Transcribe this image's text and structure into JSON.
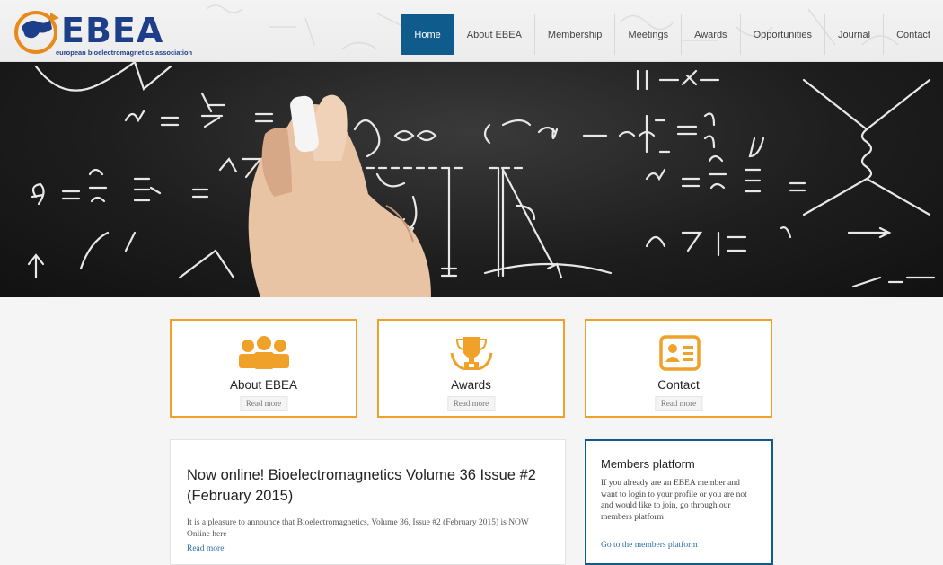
{
  "brand": {
    "name": "EBEA",
    "tagline": "european bioelectromagnetics association",
    "logo_colors": {
      "ring": "#e8891c",
      "text": "#1d3f8a"
    }
  },
  "nav": {
    "items": [
      {
        "label": "Home",
        "active": true
      },
      {
        "label": "About EBEA",
        "active": false
      },
      {
        "label": "Membership",
        "active": false
      },
      {
        "label": "Meetings",
        "active": false
      },
      {
        "label": "Awards",
        "active": false
      },
      {
        "label": "Opportunities",
        "active": false
      },
      {
        "label": "Journal",
        "active": false
      },
      {
        "label": "Contact",
        "active": false
      }
    ],
    "active_color": "#0f5b8c"
  },
  "features": [
    {
      "icon": "people-group-icon",
      "title": "About EBEA",
      "more": "Read more"
    },
    {
      "icon": "trophy-icon",
      "title": "Awards",
      "more": "Read more"
    },
    {
      "icon": "id-card-icon",
      "title": "Contact",
      "more": "Read more"
    }
  ],
  "news": {
    "title": "Now online! Bioelectromagnetics Volume 36 Issue #2 (February 2015)",
    "body": "It is a pleasure to announce that Bioelectromagnetics, Volume 36, Issue #2 (February 2015) is NOW Online here",
    "more": "Read more"
  },
  "members_platform": {
    "title": "Members platform",
    "body": "If you already are an EBEA member and want to login to your profile or you are not and would like to join, go through our members platform!",
    "link": "Go to the members platform"
  },
  "colors": {
    "accent": "#f0a12a",
    "primary": "#0f5b8c",
    "link": "#2b6fa6"
  }
}
